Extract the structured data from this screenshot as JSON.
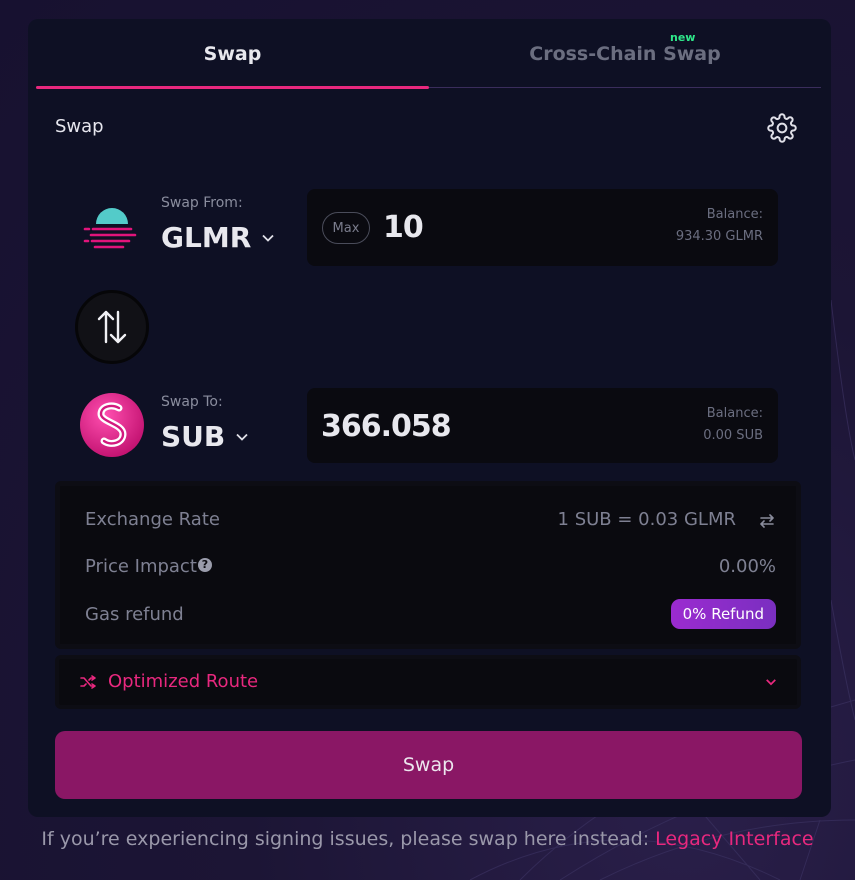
{
  "tabs": [
    {
      "label": "Swap",
      "active": true
    },
    {
      "label": "Cross-Chain Swap",
      "active": false,
      "badge": "new"
    }
  ],
  "panel": {
    "title": "Swap",
    "settings_icon": "gear-icon"
  },
  "from": {
    "caption": "Swap From:",
    "token": "GLMR",
    "max_label": "Max",
    "amount": "10",
    "balance_label": "Balance:",
    "balance_value": "934.30 GLMR"
  },
  "to": {
    "caption": "Swap To:",
    "token": "SUB",
    "amount": "366.058",
    "balance_label": "Balance:",
    "balance_value": "0.00 SUB"
  },
  "details": {
    "exchange_rate_label": "Exchange Rate",
    "exchange_rate_value": "1 SUB = 0.03 GLMR",
    "price_impact_label": "Price Impact",
    "price_impact_value": "0.00%",
    "gas_refund_label": "Gas refund",
    "gas_refund_value": "0% Refund"
  },
  "route": {
    "label": "Optimized Route"
  },
  "swap_button": "Swap",
  "footer": {
    "text": "If you’re experiencing signing issues, please swap here instead: ",
    "link": "Legacy Interface"
  },
  "colors": {
    "accent": "#e8287e",
    "card": "#0e1024",
    "button": "#8a1765",
    "new_badge": "#2ee88a"
  }
}
